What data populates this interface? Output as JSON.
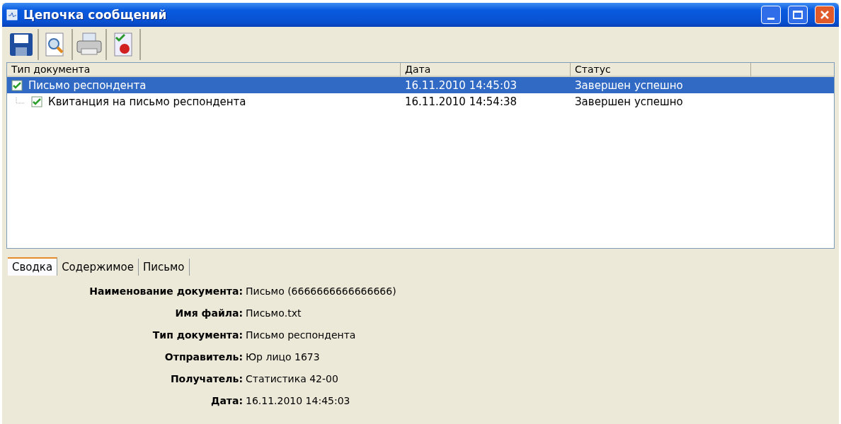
{
  "window": {
    "title": "Цепочка сообщений"
  },
  "toolbar": [
    {
      "kind": "save"
    },
    {
      "kind": "preview"
    },
    {
      "kind": "print"
    },
    {
      "kind": "certificate"
    }
  ],
  "table": {
    "columns": [
      "Тип документа",
      "Дата",
      "Статус"
    ],
    "rows": [
      {
        "type": "Письмо респондента",
        "date": "16.11.2010 14:45:03",
        "status": "Завершен успешно",
        "selected": true,
        "checked": true,
        "children": [
          {
            "type": "Квитанция на письмо респондента",
            "date": "16.11.2010 14:54:38",
            "status": "Завершен успешно",
            "selected": false,
            "checked": true
          }
        ]
      }
    ]
  },
  "tabs": [
    {
      "label": "Сводка",
      "selected": true
    },
    {
      "label": "Содержимое",
      "selected": false
    },
    {
      "label": "Письмо",
      "selected": false
    }
  ],
  "details": [
    {
      "label": "Наименование документа:",
      "value": "Письмо (6666666666666666)"
    },
    {
      "label": "Имя файла:",
      "value": "Письмо.txt"
    },
    {
      "label": "Тип документа:",
      "value": "Письмо респондента"
    },
    {
      "label": "Отправитель:",
      "value": "Юр лицо 1673"
    },
    {
      "label": "Получатель:",
      "value": "Статистика 42-00"
    },
    {
      "label": "Дата:",
      "value": "16.11.2010 14:45:03"
    }
  ]
}
